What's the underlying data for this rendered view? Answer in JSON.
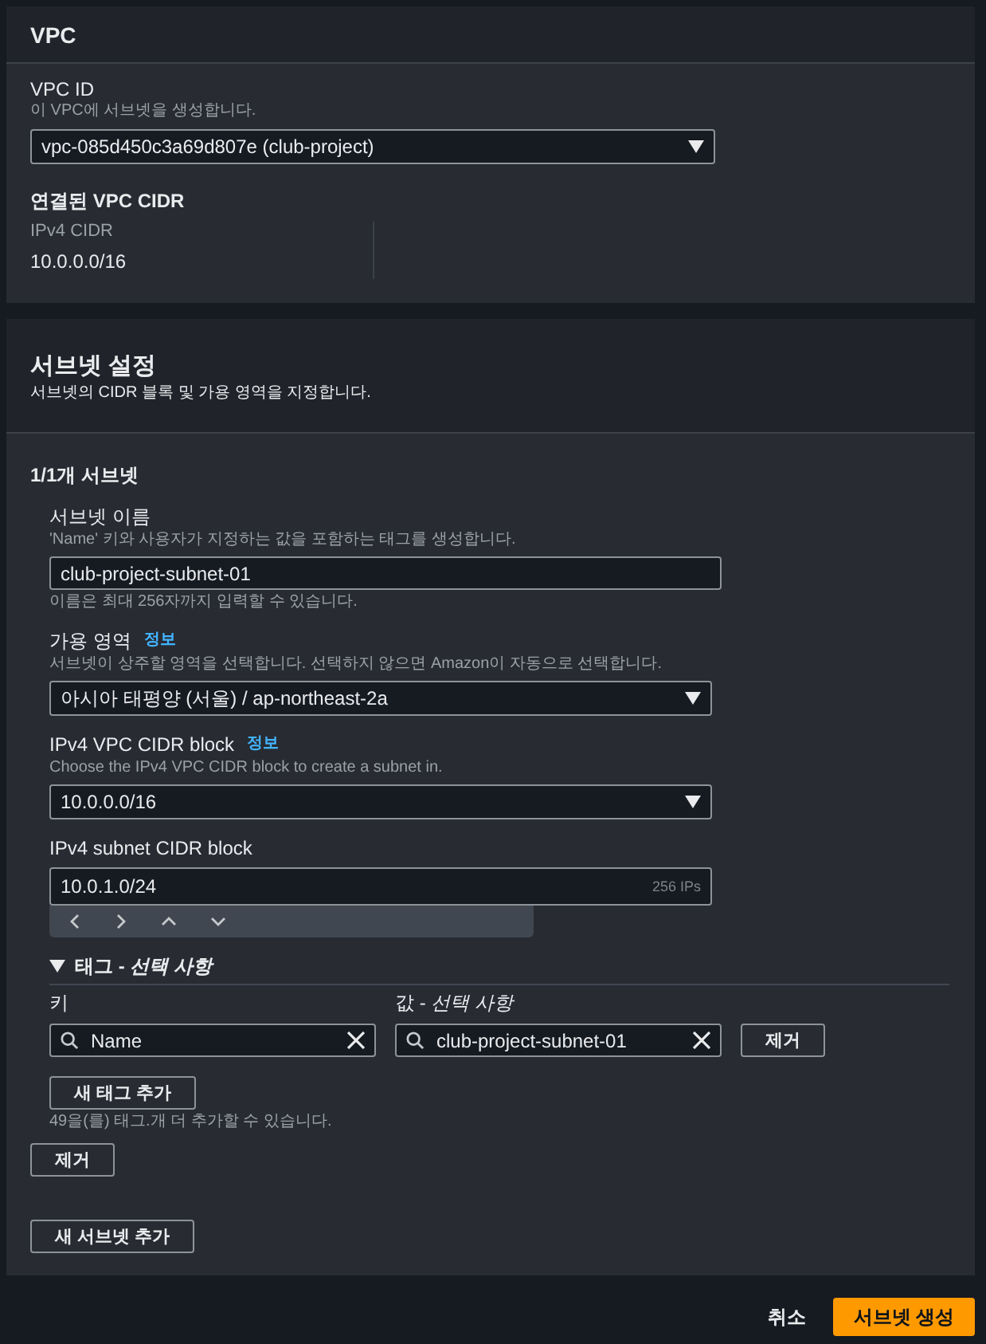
{
  "vpc_panel": {
    "title": "VPC",
    "vpc_id": {
      "label": "VPC ID",
      "description": "이 VPC에 서브넷을 생성합니다.",
      "value": "vpc-085d450c3a69d807e (club-project)"
    },
    "cidr_section": {
      "title": "연결된 VPC CIDR",
      "label": "IPv4 CIDR",
      "value": "10.0.0.0/16"
    }
  },
  "subnet_panel": {
    "title": "서브넷 설정",
    "description": "서브넷의 CIDR 블록 및 가용 영역을 지정합니다.",
    "subnet_heading": "1/1개 서브넷",
    "fields": [
      {
        "kind": "text",
        "label": "서브넷 이름",
        "description": "'Name' 키와 사용자가 지정하는 값을 포함하는 태그를 생성합니다.",
        "value": "club-project-subnet-01",
        "hint": "이름은 최대 256자까지 입력할 수 있습니다."
      },
      {
        "kind": "select",
        "label": "가용 영역",
        "info": "정보",
        "description": "서브넷이 상주할 영역을 선택합니다. 선택하지 않으면 Amazon이 자동으로 선택합니다.",
        "value": "아시아 태평양 (서울) / ap-northeast-2a"
      },
      {
        "kind": "select",
        "label": "IPv4 VPC CIDR block",
        "info": "정보",
        "description": "Choose the IPv4 VPC CIDR block to create a subnet in.",
        "value": "10.0.0.0/16"
      },
      {
        "kind": "cidr",
        "label": "IPv4 subnet CIDR block",
        "value": "10.0.1.0/24",
        "suffix": "256 IPs"
      }
    ],
    "tags": {
      "title": "태그 - *선택 사항*",
      "expanded": true,
      "key_label": "키",
      "value_label": "값 - *선택 사항*",
      "rows": [
        {
          "key": "Name",
          "value": "club-project-subnet-01",
          "remove": "제거"
        }
      ],
      "add_button": "새 태그 추가",
      "remaining_note": "49을(를) 태그.개 더 추가할 수 있습니다."
    },
    "remove_subnet_button": "제거",
    "add_subnet_button": "새 서브넷 추가"
  },
  "footer": {
    "cancel": "취소",
    "submit": "서브넷 생성"
  }
}
